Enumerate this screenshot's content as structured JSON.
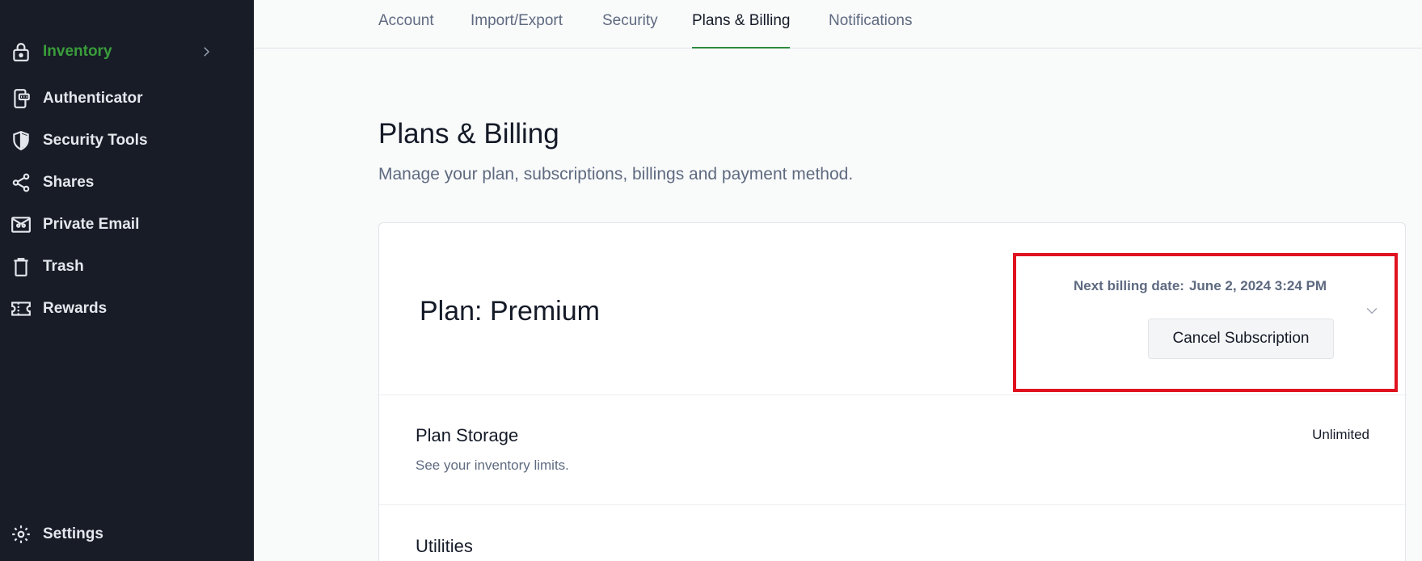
{
  "sidebar": {
    "items": [
      {
        "label": "Inventory",
        "icon": "lock-icon",
        "active": true
      },
      {
        "label": "Authenticator",
        "icon": "authenticator-icon"
      },
      {
        "label": "Security Tools",
        "icon": "shield-icon"
      },
      {
        "label": "Shares",
        "icon": "share-icon"
      },
      {
        "label": "Private Email",
        "icon": "mask-email-icon"
      },
      {
        "label": "Trash",
        "icon": "trash-icon"
      },
      {
        "label": "Rewards",
        "icon": "ticket-icon"
      }
    ],
    "settings_label": "Settings"
  },
  "tabs": [
    {
      "label": "Account"
    },
    {
      "label": "Import/Export"
    },
    {
      "label": "Security"
    },
    {
      "label": "Plans & Billing",
      "active": true
    },
    {
      "label": "Notifications"
    }
  ],
  "page": {
    "title": "Plans & Billing",
    "subtitle": "Manage your plan, subscriptions, billings and payment method."
  },
  "plan": {
    "title": "Plan: Premium",
    "next_billing_label": "Next billing date:",
    "next_billing_value": "June 2, 2024 3:24 PM",
    "cancel_label": "Cancel Subscription"
  },
  "rows": [
    {
      "title": "Plan Storage",
      "subtitle": "See your inventory limits.",
      "value": "Unlimited"
    },
    {
      "title": "Utilities"
    }
  ],
  "colors": {
    "sidebar_bg": "#171c27",
    "accent_green": "#3a9d3a",
    "highlight_red": "#e0121f"
  }
}
